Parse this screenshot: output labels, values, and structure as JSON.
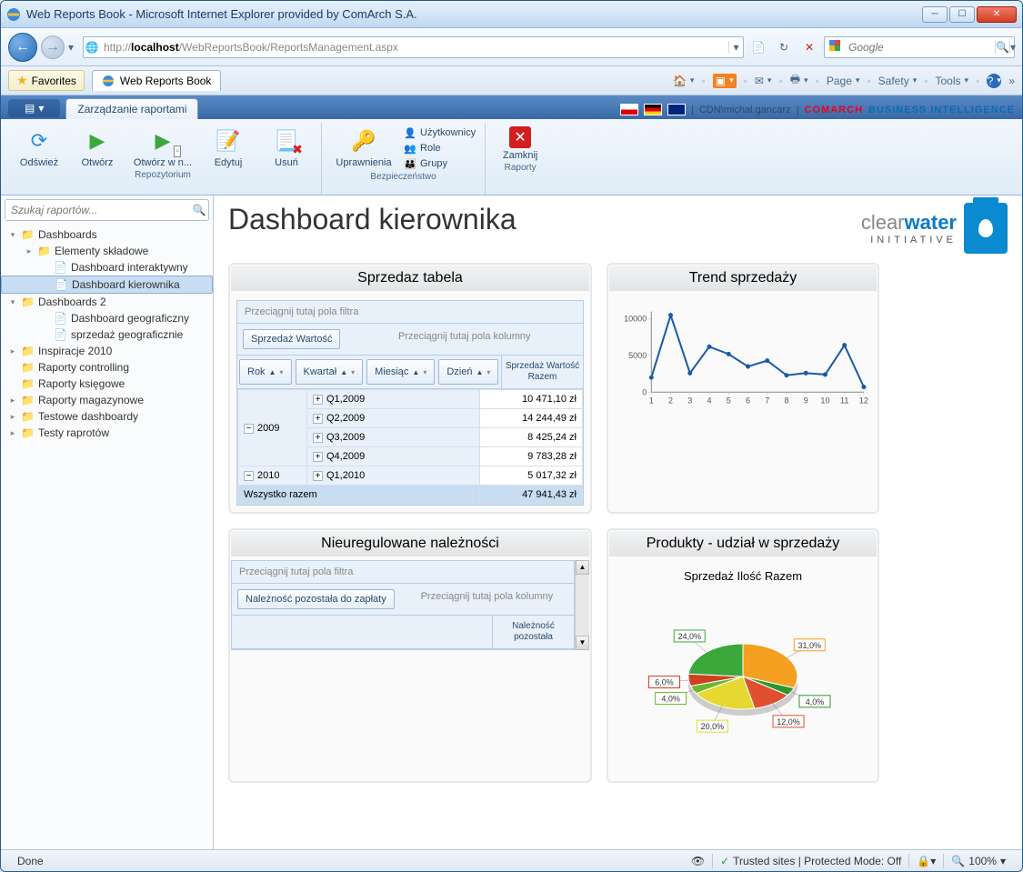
{
  "window": {
    "title": "Web Reports Book - Microsoft Internet Explorer provided by ComArch S.A."
  },
  "nav": {
    "url_host": "localhost",
    "url_pre": "http://",
    "url_path": "/WebReportsBook/ReportsManagement.aspx",
    "search_placeholder": "Google"
  },
  "tabs": {
    "favorites": "Favorites",
    "tab_title": "Web Reports Book"
  },
  "toolbar": {
    "page": "Page",
    "safety": "Safety",
    "tools": "Tools"
  },
  "ribbon": {
    "tab": "Zarządzanie raportami",
    "user": "CDN\\michal.gancarz",
    "brand1": "COMARCH",
    "brand2": "BUSINESS INTELLIGENCE",
    "groups": {
      "repo": {
        "title": "Repozytorium",
        "refresh": "Odśwież",
        "open": "Otwórz",
        "open_new": "Otwórz w n...",
        "edit": "Edytuj",
        "delete": "Usuń"
      },
      "sec": {
        "title": "Bezpieczeństwo",
        "perms": "Uprawnienia",
        "users": "Użytkownicy",
        "roles": "Role",
        "groups": "Grupy"
      },
      "rep": {
        "title": "Raporty",
        "close": "Zamknij"
      }
    }
  },
  "sidebar": {
    "search_placeholder": "Szukaj raportów...",
    "tree": [
      {
        "lbl": "Dashboards",
        "depth": 0,
        "type": "folder",
        "expanded": true
      },
      {
        "lbl": "Elementy składowe",
        "depth": 1,
        "type": "folder",
        "arrow": true
      },
      {
        "lbl": "Dashboard interaktywny",
        "depth": 2,
        "type": "doc"
      },
      {
        "lbl": "Dashboard kierownika",
        "depth": 2,
        "type": "doc",
        "selected": true
      },
      {
        "lbl": "Dashboards 2",
        "depth": 0,
        "type": "folder",
        "expanded": true
      },
      {
        "lbl": "Dashboard geograficzny",
        "depth": 2,
        "type": "doc"
      },
      {
        "lbl": "sprzedaż geograficznie",
        "depth": 2,
        "type": "doc"
      },
      {
        "lbl": "Inspiracje 2010",
        "depth": 0,
        "type": "folder",
        "arrow": true
      },
      {
        "lbl": "Raporty controlling",
        "depth": 0,
        "type": "folder"
      },
      {
        "lbl": "Raporty księgowe",
        "depth": 0,
        "type": "folder"
      },
      {
        "lbl": "Raporty magazynowe",
        "depth": 0,
        "type": "folder",
        "arrow": true
      },
      {
        "lbl": "Testowe dashboardy",
        "depth": 0,
        "type": "folder",
        "arrow": true
      },
      {
        "lbl": "Testy raprotów",
        "depth": 0,
        "type": "folder",
        "arrow": true
      }
    ]
  },
  "dashboard": {
    "title": "Dashboard kierownika",
    "logo": {
      "part1": "clear",
      "part2": "water",
      "part3": "INITIATIVE"
    }
  },
  "sales_table": {
    "title": "Sprzedaz tabela",
    "filter_hint": "Przeciągnij tutaj pola filtra",
    "measure": "Sprzedaż Wartość",
    "col_hint": "Przeciągnij tutaj pola kolumny",
    "dims": [
      "Rok",
      "Kwartał",
      "Miesiąc",
      "Dzień"
    ],
    "val_head": "Sprzedaż Wartość Razem",
    "rows": [
      {
        "year": "2009",
        "expand": "-",
        "q": "Q1,2009",
        "val": "10 471,10 zł"
      },
      {
        "year": "",
        "q": "Q2,2009",
        "val": "14 244,49 zł"
      },
      {
        "year": "",
        "q": "Q3,2009",
        "val": "8 425,24 zł"
      },
      {
        "year": "",
        "q": "Q4,2009",
        "val": "9 783,28 zł"
      },
      {
        "year": "2010",
        "expand": "-",
        "q": "Q1,2010",
        "val": "5 017,32 zł"
      }
    ],
    "total_lbl": "Wszystko razem",
    "total_val": "47 941,43 zł"
  },
  "receivables": {
    "title": "Nieuregulowane należności",
    "filter_hint": "Przeciągnij tutaj pola filtra",
    "measure": "Należność pozostała do zapłaty",
    "col_hint": "Przeciągnij tutaj pola kolumny",
    "val_head": "Należność pozostała"
  },
  "trend": {
    "title": "Trend sprzedaży"
  },
  "pie": {
    "title": "Produkty - udział w sprzedaży",
    "subtitle": "Sprzedaż Ilość Razem",
    "labels": [
      "31,0%",
      "4,0%",
      "12,0%",
      "20,0%",
      "4,0%",
      "6,0%",
      "24,0%"
    ]
  },
  "chart_data": {
    "trend": {
      "type": "line",
      "x": [
        1,
        2,
        3,
        4,
        5,
        6,
        7,
        8,
        9,
        10,
        11,
        12
      ],
      "values": [
        2000,
        10500,
        2600,
        6200,
        5200,
        3500,
        4300,
        2300,
        2600,
        2400,
        6400,
        700
      ],
      "ylim": [
        0,
        10000
      ],
      "yticks": [
        0,
        5000,
        10000
      ],
      "xlabel": "",
      "ylabel": ""
    },
    "pie": {
      "type": "pie",
      "slices": [
        {
          "label": "31,0%",
          "value": 31.0,
          "color": "#f5a020"
        },
        {
          "label": "4,0%",
          "value": 4.0,
          "color": "#2a9a2a"
        },
        {
          "label": "12,0%",
          "value": 12.0,
          "color": "#e05030"
        },
        {
          "label": "20,0%",
          "value": 20.0,
          "color": "#e6d830"
        },
        {
          "label": "4,0%",
          "value": 4.0,
          "color": "#6ab82a"
        },
        {
          "label": "6,0%",
          "value": 6.0,
          "color": "#d04020"
        },
        {
          "label": "24,0%",
          "value": 24.0,
          "color": "#3aa83a"
        }
      ]
    }
  },
  "status": {
    "done": "Done",
    "trusted": "Trusted sites | Protected Mode: Off",
    "zoom": "100%"
  }
}
